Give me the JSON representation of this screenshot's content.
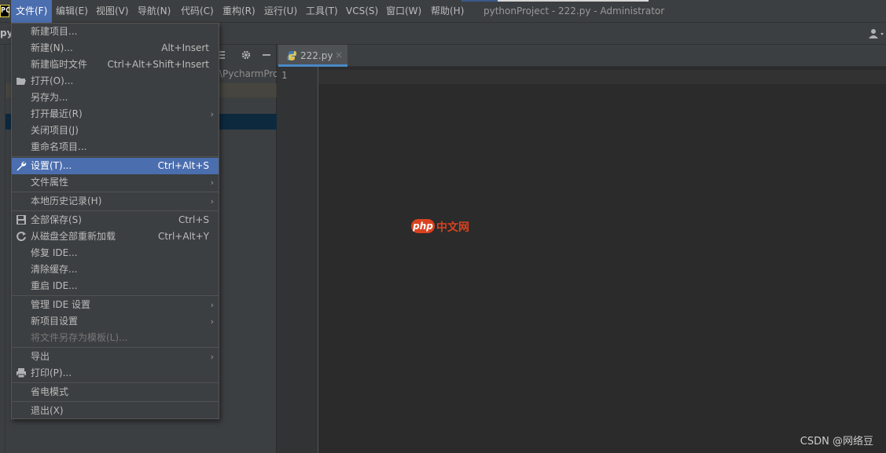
{
  "app": {
    "logo_text": "PC",
    "window_title": "pythonProject - 222.py - Administrator"
  },
  "menubar": [
    {
      "label": "文件(F)",
      "active": true
    },
    {
      "label": "编辑(E)"
    },
    {
      "label": "视图(V)"
    },
    {
      "label": "导航(N)"
    },
    {
      "label": "代码(C)"
    },
    {
      "label": "重构(R)"
    },
    {
      "label": "运行(U)"
    },
    {
      "label": "工具(T)"
    },
    {
      "label": "VCS(S)"
    },
    {
      "label": "窗口(W)"
    },
    {
      "label": "帮助(H)"
    }
  ],
  "navbar": {
    "project": "py",
    "user_icon": "user-icon"
  },
  "project_panel": {
    "path_fragment": "\\PycharmProj"
  },
  "editor": {
    "tab_label": "222.py",
    "tab_close": "×",
    "line_numbers": [
      "1"
    ]
  },
  "file_menu": {
    "items": [
      {
        "label": "新建项目...",
        "shortcut": ""
      },
      {
        "label": "新建(N)...",
        "shortcut": "Alt+Insert"
      },
      {
        "label": "新建临时文件",
        "shortcut": "Ctrl+Alt+Shift+Insert"
      },
      {
        "label": "打开(O)...",
        "shortcut": "",
        "icon": "folder-open-icon"
      },
      {
        "label": "另存为...",
        "shortcut": ""
      },
      {
        "label": "打开最近(R)",
        "shortcut": "",
        "submenu": true
      },
      {
        "label": "关闭项目(J)",
        "shortcut": ""
      },
      {
        "label": "重命名项目...",
        "shortcut": ""
      },
      {
        "label": "设置(T)...",
        "shortcut": "Ctrl+Alt+S",
        "icon": "wrench-icon",
        "selected": true
      },
      {
        "label": "文件属性",
        "shortcut": "",
        "submenu": true
      },
      {
        "label": "本地历史记录(H)",
        "shortcut": "",
        "submenu": true
      },
      {
        "label": "全部保存(S)",
        "shortcut": "Ctrl+S",
        "icon": "save-icon"
      },
      {
        "label": "从磁盘全部重新加载",
        "shortcut": "Ctrl+Alt+Y",
        "icon": "reload-icon"
      },
      {
        "label": "修复 IDE...",
        "shortcut": ""
      },
      {
        "label": "清除缓存...",
        "shortcut": ""
      },
      {
        "label": "重启 IDE...",
        "shortcut": ""
      },
      {
        "label": "管理 IDE 设置",
        "shortcut": "",
        "submenu": true
      },
      {
        "label": "新项目设置",
        "shortcut": "",
        "submenu": true
      },
      {
        "label": "将文件另存为模板(L)...",
        "shortcut": "",
        "disabled": true
      },
      {
        "label": "导出",
        "shortcut": "",
        "submenu": true
      },
      {
        "label": "打印(P)...",
        "shortcut": "",
        "icon": "print-icon"
      },
      {
        "label": "省电模式",
        "shortcut": ""
      },
      {
        "label": "退出(X)",
        "shortcut": ""
      }
    ],
    "submenu_arrow": "›"
  },
  "watermarks": {
    "php_logo": "php",
    "php_text": "中文网",
    "csdn": "CSDN @网络豆"
  },
  "colors": {
    "menu_bg": "#3c3f41",
    "selection": "#4b6eaf",
    "editor_bg": "#2b2b2b"
  }
}
